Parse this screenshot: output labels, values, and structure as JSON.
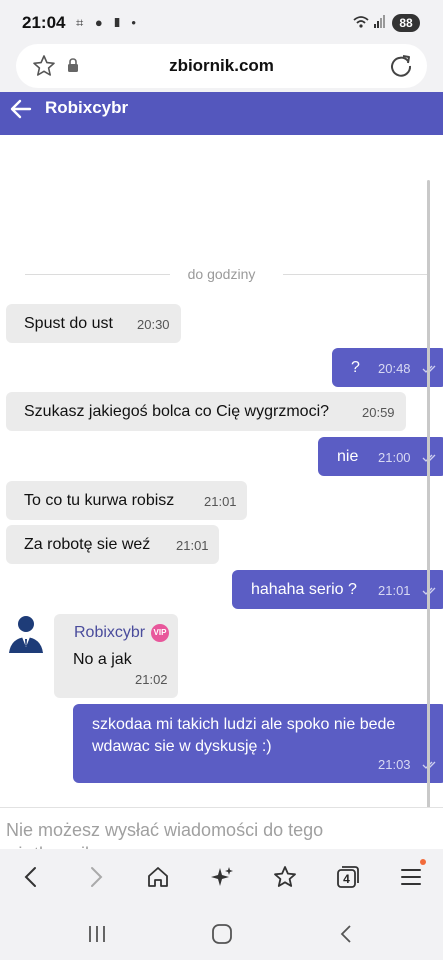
{
  "status_bar": {
    "time": "21:04",
    "notification_icons": "⌗ ● ❚ •",
    "battery": "88"
  },
  "browser": {
    "url": "zbiornik.com",
    "toolbar": {
      "tabs_count": "4",
      "notification_color": "#f26b3a"
    }
  },
  "chat": {
    "title": "Robixcybr",
    "accent_color": "#5457bd",
    "divider_label": "do godziny",
    "messages": [
      {
        "dir": "in",
        "text": "Spust do ust",
        "time": "20:30"
      },
      {
        "dir": "out",
        "text": "?",
        "time": "20:48"
      },
      {
        "dir": "in",
        "text": "Szukasz jakiegoś bolca co Cię wygrzmoci?",
        "time": "20:59"
      },
      {
        "dir": "out",
        "text": "nie",
        "time": "21:00"
      },
      {
        "dir": "in",
        "text": "To co tu kurwa robisz",
        "time": "21:01"
      },
      {
        "dir": "in",
        "text": "Za robotę sie weź",
        "time": "21:01"
      },
      {
        "dir": "out",
        "text": "hahaha serio ?",
        "time": "21:01"
      },
      {
        "dir": "in",
        "sender": "Robixcybr",
        "badge": "VIP",
        "text": "No a jak",
        "time": "21:02"
      },
      {
        "dir": "out",
        "text": "szkodaa mi takich ludzi ale spoko nie bede wdawac sie w dyskusję :)",
        "time": "21:03"
      }
    ],
    "input_placeholder": "Nie możesz wysłać wiadomości do tego użytkownika"
  },
  "icons": [
    "star-icon",
    "lock-icon",
    "reload-icon",
    "back-arrow-icon",
    "avatar-icon",
    "chevron-left-icon",
    "chevron-right-icon",
    "home-icon",
    "sparkle-icon",
    "star-list-icon",
    "tabs-icon",
    "menu-icon",
    "recents-icon",
    "home-circle-icon",
    "back-icon"
  ]
}
